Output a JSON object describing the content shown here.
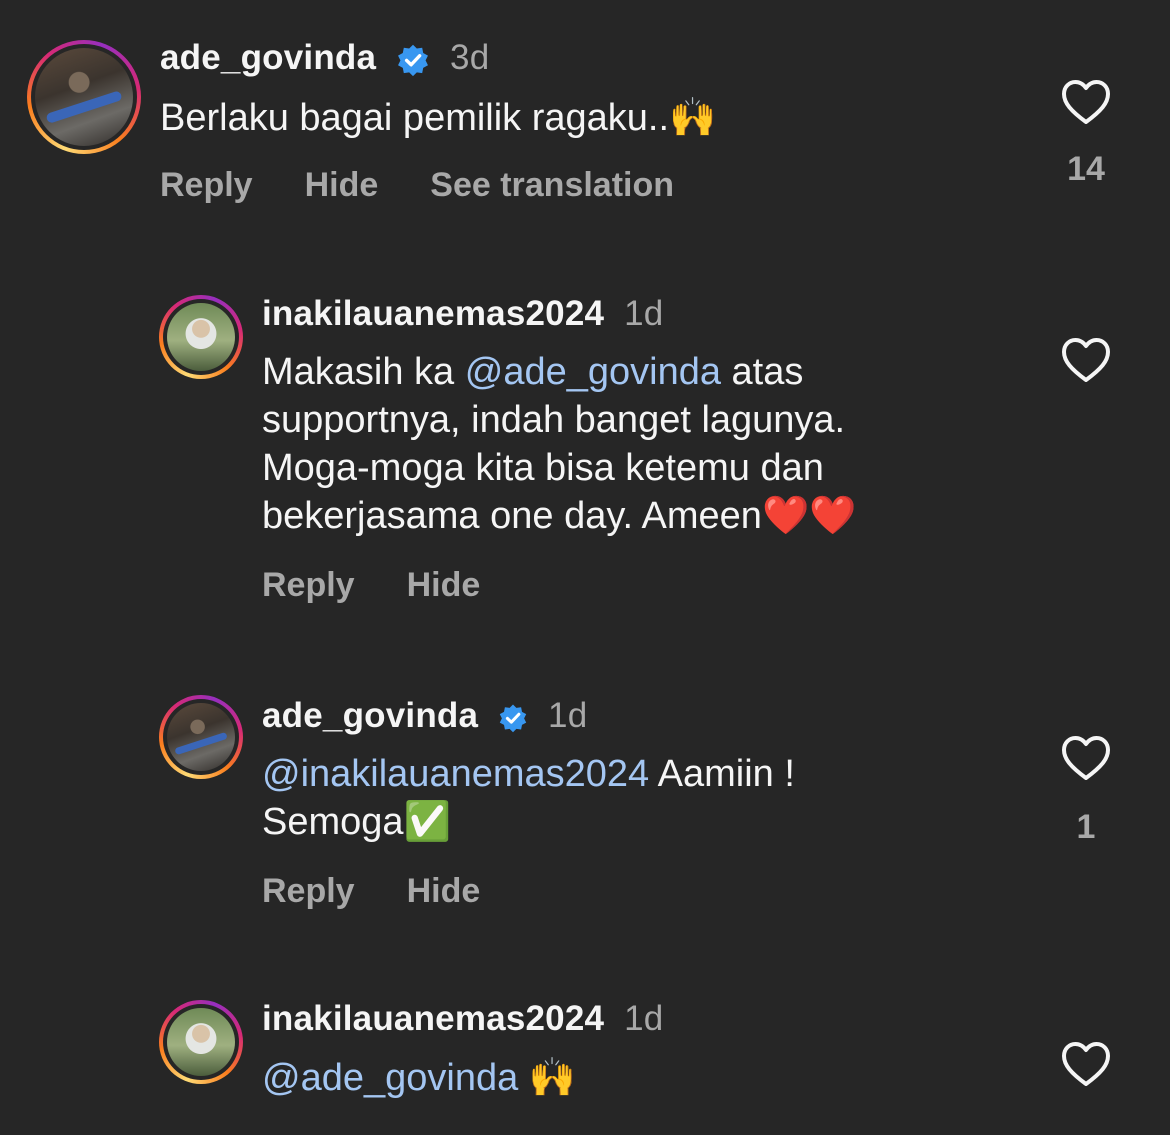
{
  "comments": [
    {
      "username": "ade_govinda",
      "verified": true,
      "time": "3d",
      "text": "Berlaku bagai pemilik ragaku..🙌",
      "actions": {
        "reply": "Reply",
        "hide": "Hide",
        "translate": "See translation"
      },
      "likes": "14"
    },
    {
      "username": "inakilauanemas2024",
      "verified": false,
      "time": "1d",
      "text_before": "Makasih ka ",
      "mention": "@ade_govinda",
      "text_after_line1": " atas",
      "text_line2": "supportnya, indah banget lagunya.",
      "text_line3": "Moga-moga kita bisa ketemu dan",
      "text_line4": "bekerjasama one day. Ameen❤️❤️",
      "actions": {
        "reply": "Reply",
        "hide": "Hide"
      }
    },
    {
      "username": "ade_govinda",
      "verified": true,
      "time": "1d",
      "mention": "@inakilauanemas2024",
      "text_after": " Aamiin !",
      "text_line2": "Semoga✅",
      "actions": {
        "reply": "Reply",
        "hide": "Hide"
      },
      "likes": "1"
    },
    {
      "username": "inakilauanemas2024",
      "verified": false,
      "time": "1d",
      "mention": "@ade_govinda",
      "text_after": " 🙌"
    }
  ],
  "colors": {
    "background": "#262626",
    "mention": "#a4c6f2",
    "secondary_text": "#a8a8a8",
    "verified_badge": "#3897f0"
  },
  "icons": {
    "like": "heart-outline-icon",
    "verified": "verified-badge-icon"
  }
}
